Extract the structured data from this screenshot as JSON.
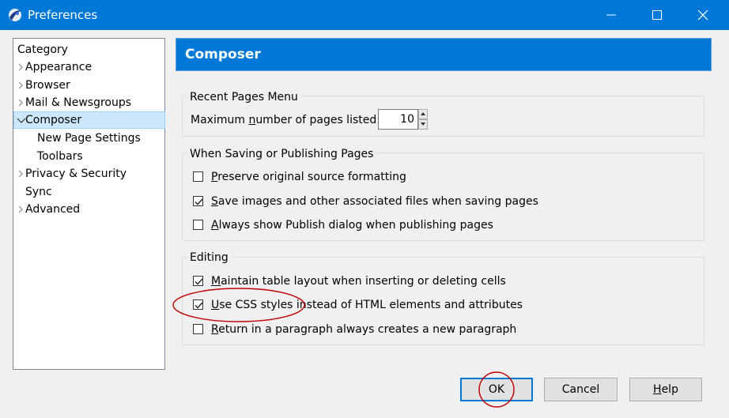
{
  "window": {
    "title": "Preferences",
    "icon": "app-icon",
    "controls": [
      "minimize-icon",
      "maximize-icon",
      "close-icon"
    ]
  },
  "category": {
    "header": "Category",
    "items": [
      {
        "label": "Appearance",
        "expandable": true,
        "expanded": false
      },
      {
        "label": "Browser",
        "expandable": true,
        "expanded": false
      },
      {
        "label": "Mail & Newsgroups",
        "expandable": true,
        "expanded": false
      },
      {
        "label": "Composer",
        "expandable": true,
        "expanded": true,
        "selected": true
      },
      {
        "label": "New Page Settings",
        "child": true
      },
      {
        "label": "Toolbars",
        "child": true
      },
      {
        "label": "Privacy & Security",
        "expandable": true,
        "expanded": false
      },
      {
        "label": "Sync",
        "expandable": false
      },
      {
        "label": "Advanced",
        "expandable": true,
        "expanded": false
      }
    ]
  },
  "panel": {
    "title": "Composer",
    "recent": {
      "legend": "Recent Pages Menu",
      "label_pre": "Maximum ",
      "label_key": "n",
      "label_post": "umber of pages listed:",
      "value": "10"
    },
    "saving": {
      "legend": "When Saving or Publishing Pages",
      "options": [
        {
          "key": "P",
          "rest": "reserve original source formatting",
          "checked": false
        },
        {
          "key": "S",
          "rest": "ave images and other associated files when saving pages",
          "checked": true
        },
        {
          "key": "A",
          "rest": "lways show Publish dialog when publishing pages",
          "checked": false
        }
      ]
    },
    "editing": {
      "legend": "Editing",
      "options": [
        {
          "key": "M",
          "rest": "aintain table layout when inserting or deleting cells",
          "checked": true
        },
        {
          "key": "U",
          "rest": "se CSS styles instead of HTML elements and attributes",
          "checked": true
        },
        {
          "key": "R",
          "rest": "eturn in a paragraph always creates a new paragraph",
          "checked": false
        }
      ]
    }
  },
  "buttons": {
    "ok": "OK",
    "cancel": "Cancel",
    "help_key": "H",
    "help_rest": "elp"
  },
  "colors": {
    "accent": "#0078d7",
    "selection": "#cce8ff",
    "annotation": "#c00000"
  }
}
